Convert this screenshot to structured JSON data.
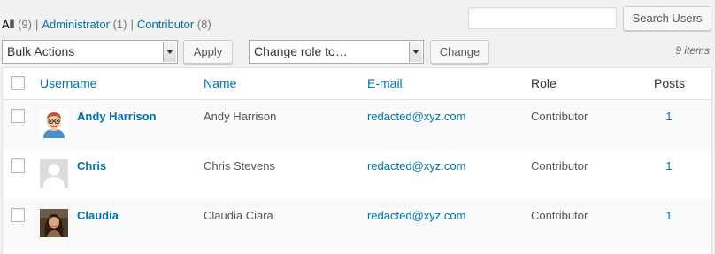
{
  "filters": {
    "all_label": "All",
    "all_count": "(9)",
    "separator": "|",
    "administrator_label": "Administrator",
    "administrator_count": "(1)",
    "contributor_label": "Contributor",
    "contributor_count": "(8)"
  },
  "search": {
    "value": "",
    "button_label": "Search Users"
  },
  "bulk_actions": {
    "selected": "Bulk Actions",
    "apply_label": "Apply"
  },
  "change_role": {
    "selected": "Change role to…",
    "change_label": "Change"
  },
  "items_count": "9 items",
  "table": {
    "headers": {
      "username": "Username",
      "name": "Name",
      "email": "E-mail",
      "role": "Role",
      "posts": "Posts"
    },
    "rows": [
      {
        "username": "Andy Harrison",
        "name": "Andy Harrison",
        "email": "redacted@xyz.com",
        "role": "Contributor",
        "posts": "1",
        "avatar": "cartoon-avatar-icon"
      },
      {
        "username": "Chris",
        "name": "Chris Stevens",
        "email": "redacted@xyz.com",
        "role": "Contributor",
        "posts": "1",
        "avatar": "default-avatar-icon"
      },
      {
        "username": "Claudia",
        "name": "Claudia Ciara",
        "email": "redacted@xyz.com",
        "role": "Contributor",
        "posts": "1",
        "avatar": "photo-avatar"
      }
    ]
  },
  "colors": {
    "link": "#0073aa",
    "background": "#f1f1f1",
    "table_background": "#ffffff",
    "alt_row_background": "#f9f9f9"
  }
}
